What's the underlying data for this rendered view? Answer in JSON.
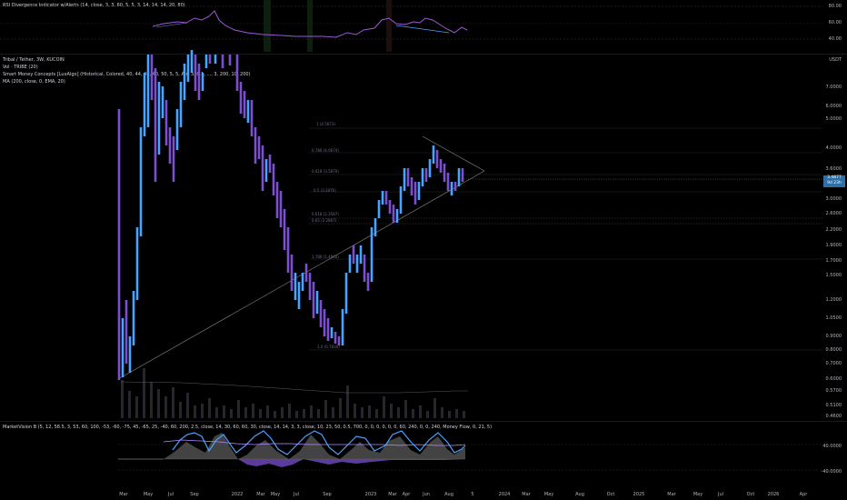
{
  "colors": {
    "background": "#000000",
    "candle_up": "#4aa3ff",
    "candle_down": "#7b4fd0",
    "rsi_line": "#9b59d6",
    "accent_price": "#2f6fa8"
  },
  "rsi_pane": {
    "title": "RSI Divergence Indicator w/Alerts (14, close, 3, 3, 60, 5, 5, 3, 14, 14, 14, 20, 80)",
    "scale": [
      "80.00",
      "60.00",
      "40.00"
    ]
  },
  "main_pane": {
    "symbol_line": "Tribal / Tether, 3W, KUCOIN",
    "indicator_1": "Vol · TRIBE (20)",
    "indicator_2": "Smart Money Concepts [LuxAlgo] (Historical, Colored, 40, 44, 40, 40, 50, 5, 5, Atr, 3, 0.1, ..., 3, 200, 10, 200)",
    "indicator_3": "MA (200, close, 0, EMA, 20)",
    "currency": "USDT",
    "current_price": "3.4877",
    "countdown": "9d 23h",
    "scale": [
      "7.0000",
      "6.0000",
      "5.0000",
      "4.0000",
      "3.6000",
      "3.0000",
      "2.6000",
      "2.2000",
      "1.9000",
      "1.7000",
      "1.5000",
      "1.2000",
      "1.0500",
      "0.9000",
      "0.8000",
      "0.7000",
      "0.6000",
      "0.5700",
      "0.5100",
      "0.4600"
    ],
    "fib_labels": [
      "1 (4.5673)",
      "0.786 (4.0674)",
      "0.618 (3.5870)",
      "0.5 (3.2876)",
      "0.382 (2.9784)",
      "0.618 (2.3587)",
      "0.65 (2.2867)",
      "1.786 (1.4840)",
      "1.0 (0.7830)"
    ]
  },
  "mv_pane": {
    "title": "MarketVision B (5, 12, 58.5, 3, 53, 60, 100, -53, -60, -75, 45, -65, 25, -40, 60, 200, 2.5, close, 14, 30, 60, 60, 30, close, 14, 14, 3, 3, close, 10, 23, 50, 0.5, 700, 0, 0, 0, 0, 0, 0, 60, 240, 0, 0, 240, Money Flow, 0, 21, 5)",
    "scale": [
      "40.0000",
      "-40.0000"
    ]
  },
  "time_axis": [
    "Mar",
    "May",
    "Jul",
    "Sep",
    "2022",
    "Mar",
    "May",
    "Jul",
    "Sep",
    "2023",
    "Mar",
    "Apr",
    "Jun",
    "Aug",
    "5",
    "2024",
    "Mar",
    "May",
    "Aug",
    "Oct",
    "2025",
    "Mar",
    "May",
    "Jul",
    "Oct",
    "2026",
    "Apr"
  ]
}
